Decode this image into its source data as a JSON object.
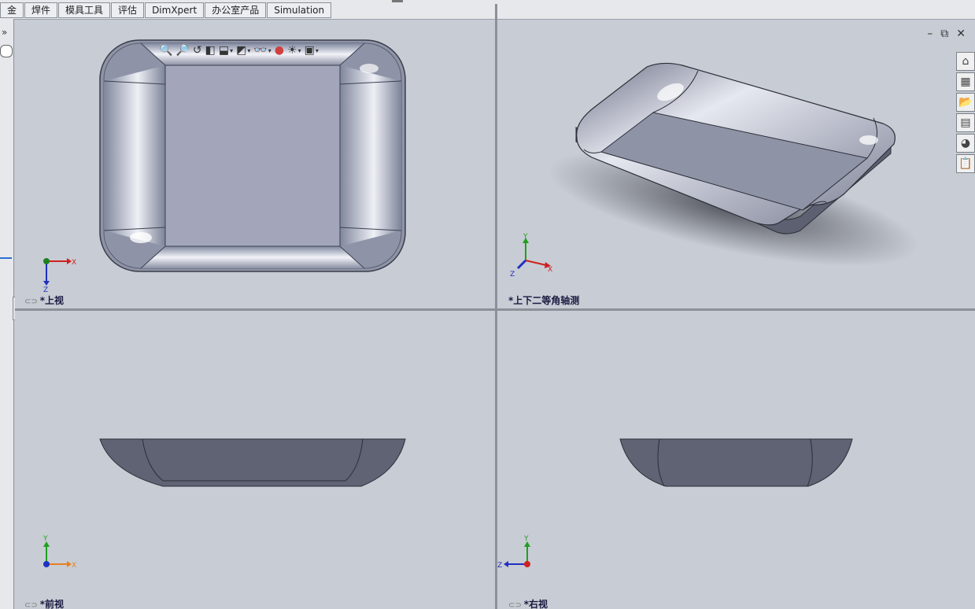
{
  "tabs": [
    "金",
    "焊件",
    "模具工具",
    "评估",
    "DimXpert",
    "办公室产品",
    "Simulation"
  ],
  "leftstrip": {
    "expand": "»"
  },
  "viewtools": [
    {
      "name": "zoom-to-fit-icon",
      "glyph": "🔍"
    },
    {
      "name": "zoom-to-area-icon",
      "glyph": "🔎"
    },
    {
      "name": "previous-view-icon",
      "glyph": "↺"
    },
    {
      "name": "section-view-icon",
      "glyph": "◧"
    },
    {
      "name": "view-orientation-icon",
      "glyph": "⬓",
      "dd": true
    },
    {
      "name": "display-style-icon",
      "glyph": "◩",
      "dd": true
    },
    {
      "name": "hide-show-items-icon",
      "glyph": "👓",
      "dd": true
    },
    {
      "name": "edit-appearance-icon",
      "glyph": "●"
    },
    {
      "name": "apply-scene-icon",
      "glyph": "☀",
      "dd": true
    },
    {
      "name": "view-settings-icon",
      "glyph": "▣",
      "dd": true
    }
  ],
  "window_controls": {
    "minimize": "–",
    "restore": "⧉",
    "close": "✕"
  },
  "taskpane": [
    {
      "name": "solidworks-resources-icon",
      "glyph": "⌂"
    },
    {
      "name": "design-library-icon",
      "glyph": "▦"
    },
    {
      "name": "file-explorer-icon",
      "glyph": "📂"
    },
    {
      "name": "view-palette-icon",
      "glyph": "▤"
    },
    {
      "name": "appearances-scenes-icon",
      "glyph": "◕"
    },
    {
      "name": "custom-properties-icon",
      "glyph": "📋"
    }
  ],
  "viewports": {
    "top": {
      "label": "*上视",
      "axes": [
        "X",
        "Z"
      ]
    },
    "iso": {
      "label": "*上下二等角轴测",
      "axes": [
        "Y",
        "X",
        "Z"
      ]
    },
    "front": {
      "label": "*前视",
      "axes": [
        "Y",
        "X"
      ]
    },
    "right": {
      "label": "*右视",
      "axes": [
        "Y",
        "Z"
      ]
    }
  },
  "colors": {
    "axis_x": "#d02020",
    "axis_y": "#20a020",
    "axis_z": "#2030c0",
    "part_body": "#8e92a6"
  }
}
